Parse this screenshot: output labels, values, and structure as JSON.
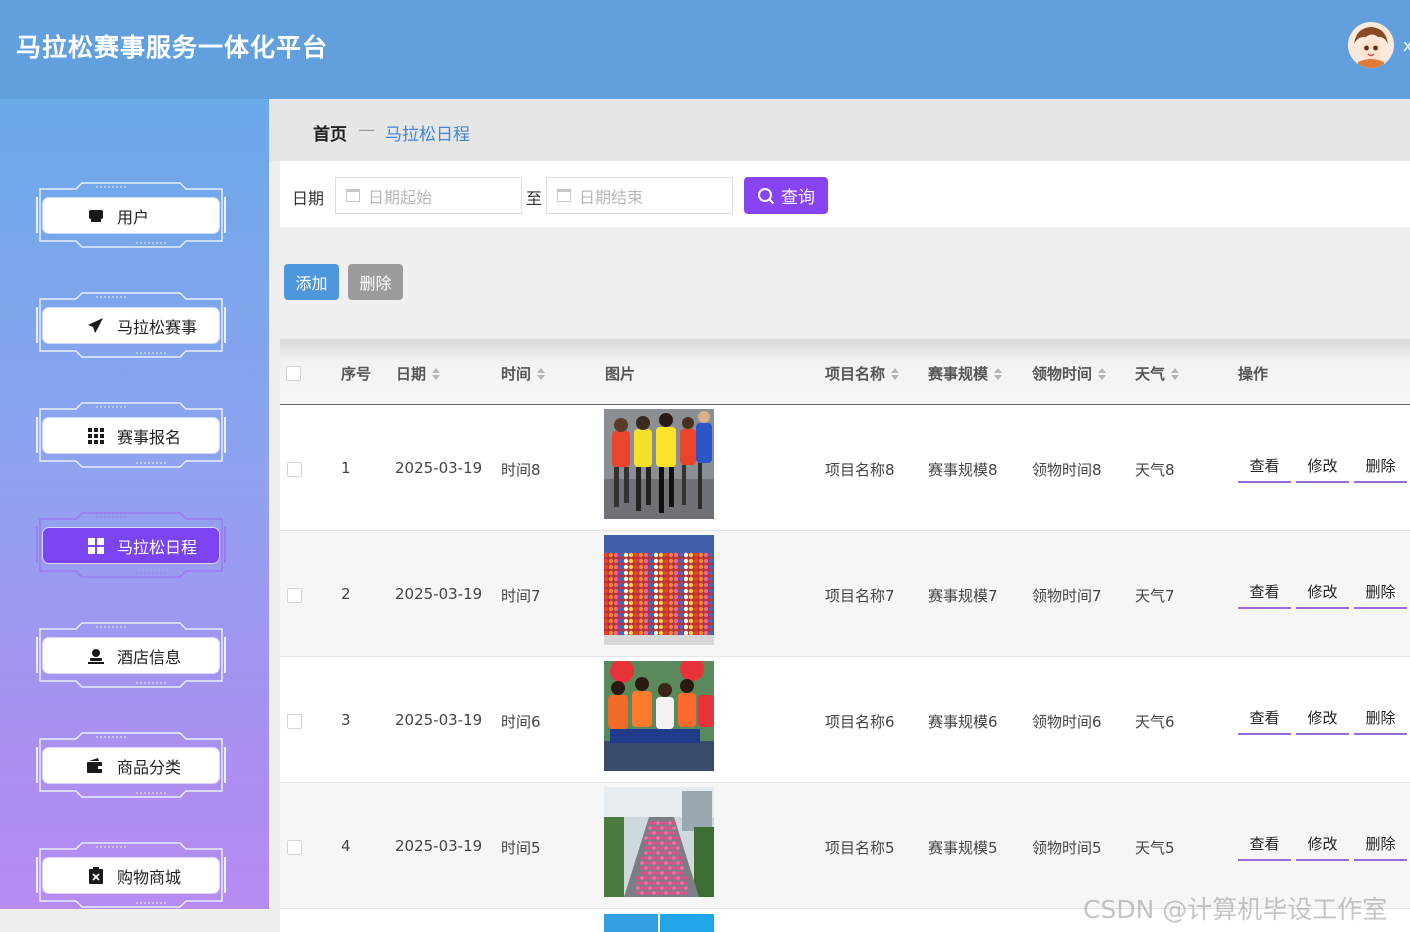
{
  "app": {
    "title": "马拉松赛事服务一体化平台",
    "user_initial": "x"
  },
  "sidebar": {
    "items": [
      {
        "label": "用户",
        "icon": "user-card-icon",
        "active": false
      },
      {
        "label": "马拉松赛事",
        "icon": "paper-plane-icon",
        "active": false
      },
      {
        "label": "赛事报名",
        "icon": "grid-icon",
        "active": false
      },
      {
        "label": "马拉松日程",
        "icon": "dashboard-icon",
        "active": true
      },
      {
        "label": "酒店信息",
        "icon": "person-icon",
        "active": false
      },
      {
        "label": "商品分类",
        "icon": "wallet-icon",
        "active": false
      },
      {
        "label": "购物商城",
        "icon": "clipboard-x-icon",
        "active": false
      }
    ]
  },
  "breadcrumb": {
    "home": "首页",
    "separator": "—",
    "current": "马拉松日程"
  },
  "search": {
    "date_label": "日期",
    "start_placeholder": "日期起始",
    "to_label": "至",
    "end_placeholder": "日期结束",
    "query_label": "查询"
  },
  "actions": {
    "add_label": "添加",
    "delete_label": "删除"
  },
  "table": {
    "columns": [
      "序号",
      "日期",
      "时间",
      "图片",
      "项目名称",
      "赛事规模",
      "领物时间",
      "天气",
      "操作"
    ],
    "rows": [
      {
        "index": "1",
        "date": "2025-03-19",
        "time": "时间8",
        "project": "项目名称8",
        "scale": "赛事规模8",
        "pickup": "领物时间8",
        "weather": "天气8"
      },
      {
        "index": "2",
        "date": "2025-03-19",
        "time": "时间7",
        "project": "项目名称7",
        "scale": "赛事规模7",
        "pickup": "领物时间7",
        "weather": "天气7"
      },
      {
        "index": "3",
        "date": "2025-03-19",
        "time": "时间6",
        "project": "项目名称6",
        "scale": "赛事规模6",
        "pickup": "领物时间6",
        "weather": "天气6"
      },
      {
        "index": "4",
        "date": "2025-03-19",
        "time": "时间5",
        "project": "项目名称5",
        "scale": "赛事规模5",
        "pickup": "领物时间5",
        "weather": "天气5"
      }
    ],
    "row_actions": {
      "view": "查看",
      "edit": "修改",
      "delete": "删除"
    }
  },
  "watermark": "CSDN @计算机毕设工作室",
  "colors": {
    "header": "#61a0dc",
    "accent": "#8843f2",
    "active_menu": "#7c43f2",
    "add_button": "#4e97dc",
    "delete_button": "#9b9b9b"
  }
}
